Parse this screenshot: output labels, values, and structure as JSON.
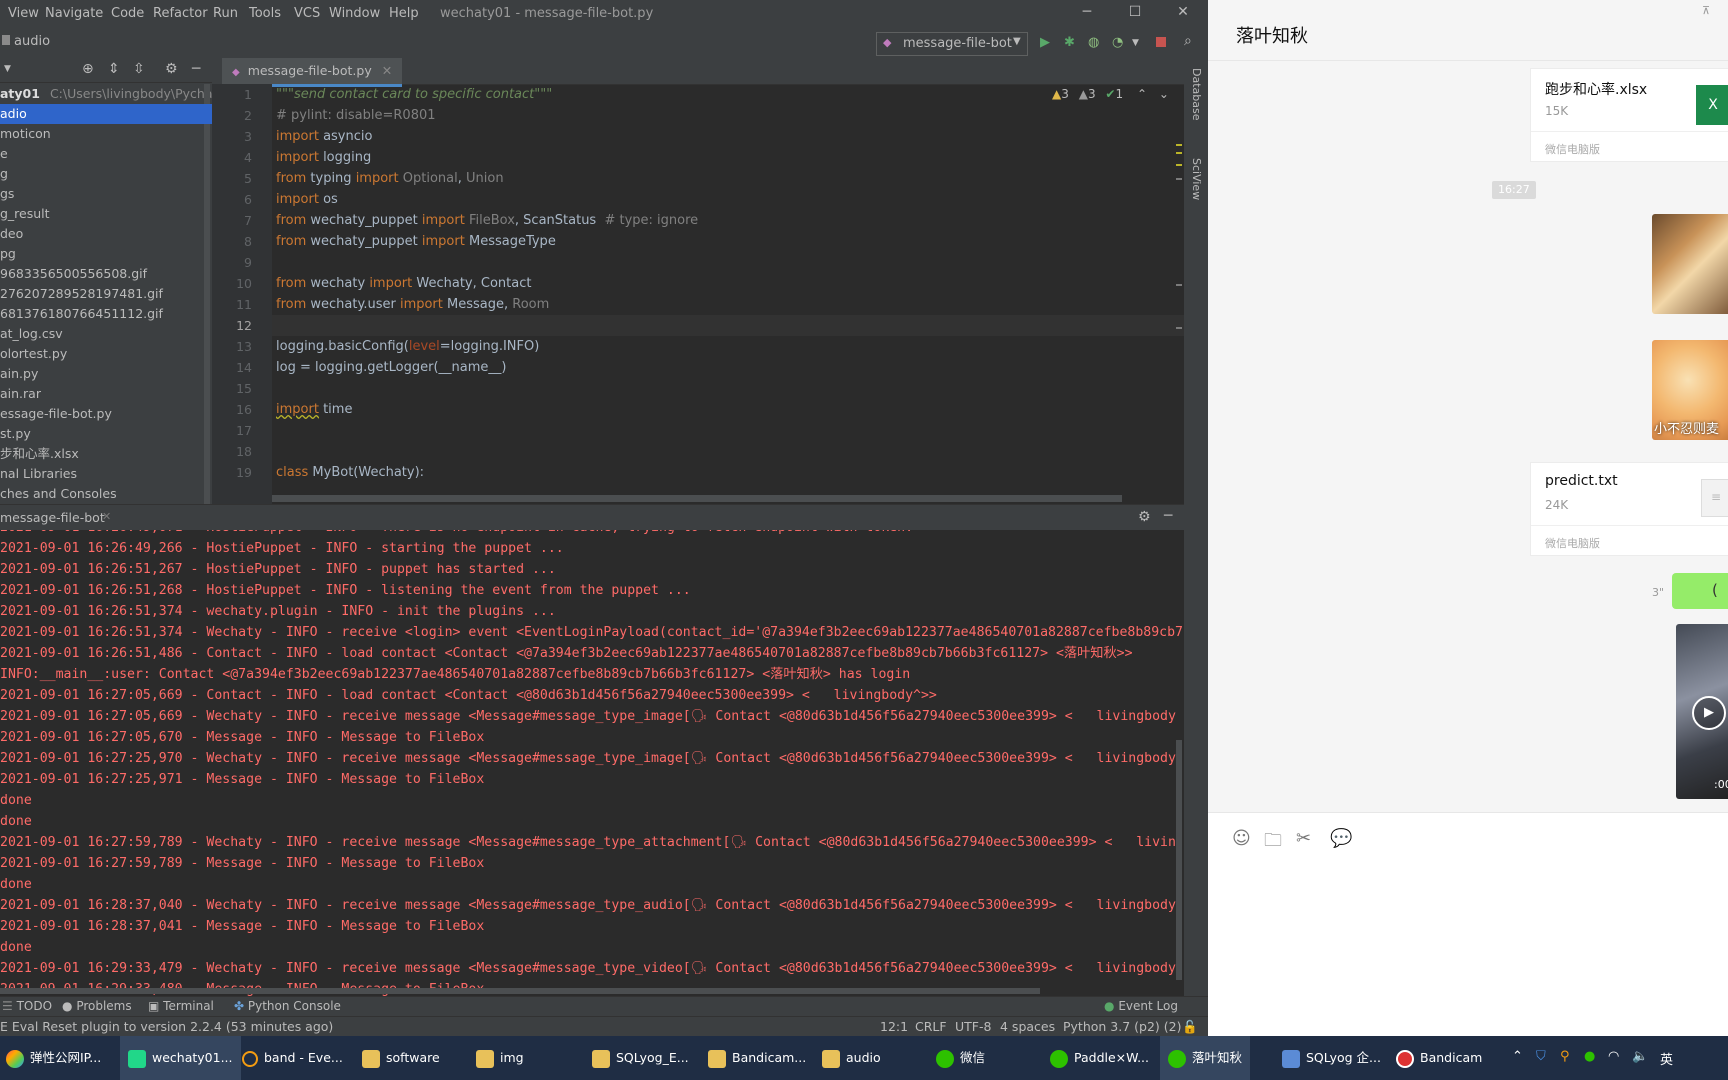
{
  "ide": {
    "menu": [
      "View",
      "Navigate",
      "Code",
      "Refactor",
      "Run",
      "Tools",
      "VCS",
      "Window",
      "Help"
    ],
    "window_title": "wechaty01 - message-file-bot.py",
    "breadcrumb": "audio",
    "run_config": "message-file-bot",
    "project": {
      "root_label": "aty01",
      "root_path": "C:\\Users\\livingbody\\PycharmP",
      "items": [
        "adio",
        "moticon",
        "e",
        "g",
        "gs",
        "g_result",
        "deo",
        "pg",
        "9683356500556508.gif",
        "276207289528197481.gif",
        "681376180766451112.gif",
        "at_log.csv",
        "olortest.py",
        "ain.py",
        "ain.rar",
        "essage-file-bot.py",
        "st.py",
        "步和心率.xlsx",
        "nal Libraries",
        "ches and Consoles"
      ],
      "selected_index": 0
    },
    "editor": {
      "tab": "message-file-bot.py",
      "inspections": {
        "warnings": "3",
        "weak": "3",
        "ok": "1"
      },
      "line_numbers": [
        "1",
        "2",
        "3",
        "4",
        "5",
        "6",
        "7",
        "8",
        "9",
        "10",
        "11",
        "12",
        "13",
        "14",
        "15",
        "16",
        "17",
        "18",
        "19"
      ],
      "current_line": 12
    },
    "run_panel": {
      "tab": "message-file-bot",
      "lines": [
        "2021-09-01 16:26:49,266 - HostiePuppet - INFO - starting the puppet ...",
        "2021-09-01 16:26:51,267 - HostiePuppet - INFO - puppet has started ...",
        "2021-09-01 16:26:51,268 - HostiePuppet - INFO - listening the event from the puppet ...",
        "2021-09-01 16:26:51,374 - wechaty.plugin - INFO - init the plugins ...",
        "2021-09-01 16:26:51,374 - Wechaty - INFO - receive <login> event <EventLoginPayload(contact_id='@7a394ef3b2eec69ab122377ae486540701a82887cefbe8b89cb7",
        "2021-09-01 16:26:51,486 - Contact - INFO - load contact <Contact <@7a394ef3b2eec69ab122377ae486540701a82887cefbe8b89cb7b66b3fc61127> <落叶知秋>>",
        "INFO:__main__:user: Contact <@7a394ef3b2eec69ab122377ae486540701a82887cefbe8b89cb7b66b3fc61127> <落叶知秋> has login",
        "2021-09-01 16:27:05,669 - Contact - INFO - load contact <Contact <@80d63b1d456f56a27940eec5300ee399> <   livingbody^>>",
        "2021-09-01 16:27:05,669 - Wechaty - INFO - receive message <Message#message_type_image[🗣 Contact <@80d63b1d456f56a27940eec5300ee399> <   livingbody",
        "2021-09-01 16:27:05,670 - Message - INFO - Message to FileBox",
        "2021-09-01 16:27:25,970 - Wechaty - INFO - receive message <Message#message_type_image[🗣 Contact <@80d63b1d456f56a27940eec5300ee399> <   livingbody",
        "2021-09-01 16:27:25,971 - Message - INFO - Message to FileBox",
        "done",
        "done",
        "2021-09-01 16:27:59,789 - Wechaty - INFO - receive message <Message#message_type_attachment[🗣 Contact <@80d63b1d456f56a27940eec5300ee399> <   livin",
        "2021-09-01 16:27:59,789 - Message - INFO - Message to FileBox",
        "done",
        "2021-09-01 16:28:37,040 - Wechaty - INFO - receive message <Message#message_type_audio[🗣 Contact <@80d63b1d456f56a27940eec5300ee399> <   livingbody",
        "2021-09-01 16:28:37,041 - Message - INFO - Message to FileBox",
        "done",
        "2021-09-01 16:29:33,479 - Wechaty - INFO - receive message <Message#message_type_video[🗣 Contact <@80d63b1d456f56a27940eec5300ee399> <   livingbody",
        "2021-09-01 16:29:33,480 - Message - INFO - Message to FileBox"
      ]
    },
    "tool_windows": [
      "TODO",
      "Problems",
      "Terminal",
      "Python Console",
      "Event Log"
    ],
    "status": {
      "message": "E Eval Reset plugin to version 2.2.4 (53 minutes ago)",
      "position": "12:1",
      "line_sep": "CRLF",
      "encoding": "UTF-8",
      "indent": "4 spaces",
      "interpreter": "Python 3.7 (p2) (2)"
    },
    "side_tabs": [
      "Database",
      "SciView"
    ]
  },
  "wechat": {
    "contact": "落叶知秋",
    "file1": {
      "name": "跑步和心率.xlsx",
      "size": "15K",
      "source": "微信电脑版"
    },
    "time_chip": "16:27",
    "sticker_caption": "小不忍则麦",
    "file2": {
      "name": "predict.txt",
      "size": "24K",
      "source": "微信电脑版"
    },
    "voice_duration": "3\"",
    "video_duration": ":00"
  },
  "taskbar": {
    "items": [
      "弹性公网IP...",
      "wechaty01...",
      "band - Eve...",
      "software",
      "img",
      "SQLyog_E...",
      "Bandicam...",
      "audio",
      "微信",
      "Paddle×W...",
      "落叶知秋",
      "SQLyog 企...",
      "Bandicam"
    ],
    "ime": "英"
  }
}
